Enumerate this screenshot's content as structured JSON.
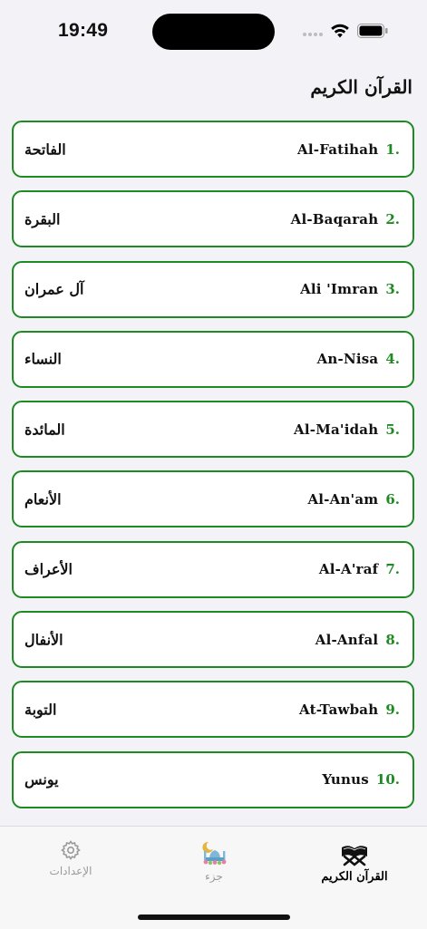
{
  "status_bar": {
    "time": "19:49"
  },
  "page": {
    "title": "القرآن الكريم"
  },
  "surahs": [
    {
      "number": "1.",
      "name": "Al-Fatihah",
      "arabic": "الفاتحة"
    },
    {
      "number": "2.",
      "name": "Al-Baqarah",
      "arabic": "البقرة"
    },
    {
      "number": "3.",
      "name": "Ali 'Imran",
      "arabic": "آل عمران"
    },
    {
      "number": "4.",
      "name": "An-Nisa",
      "arabic": "النساء"
    },
    {
      "number": "5.",
      "name": "Al-Ma'idah",
      "arabic": "المائدة"
    },
    {
      "number": "6.",
      "name": "Al-An'am",
      "arabic": "الأنعام"
    },
    {
      "number": "7.",
      "name": "Al-A'raf",
      "arabic": "الأعراف"
    },
    {
      "number": "8.",
      "name": "Al-Anfal",
      "arabic": "الأنفال"
    },
    {
      "number": "9.",
      "name": "At-Tawbah",
      "arabic": "التوبة"
    },
    {
      "number": "10.",
      "name": "Yunus",
      "arabic": "يونس"
    }
  ],
  "tabs": {
    "settings": {
      "label": "الإعدادات",
      "icon": "gear-icon"
    },
    "juz": {
      "label": "جزء",
      "icon": "mosque-icon"
    },
    "quran": {
      "label": "القرآن الكريم",
      "icon": "quran-book-icon"
    }
  },
  "colors": {
    "accent": "#1e8a22",
    "background": "#f2f2f7",
    "card": "#ffffff",
    "inactive_tab": "#9a9a9a"
  }
}
